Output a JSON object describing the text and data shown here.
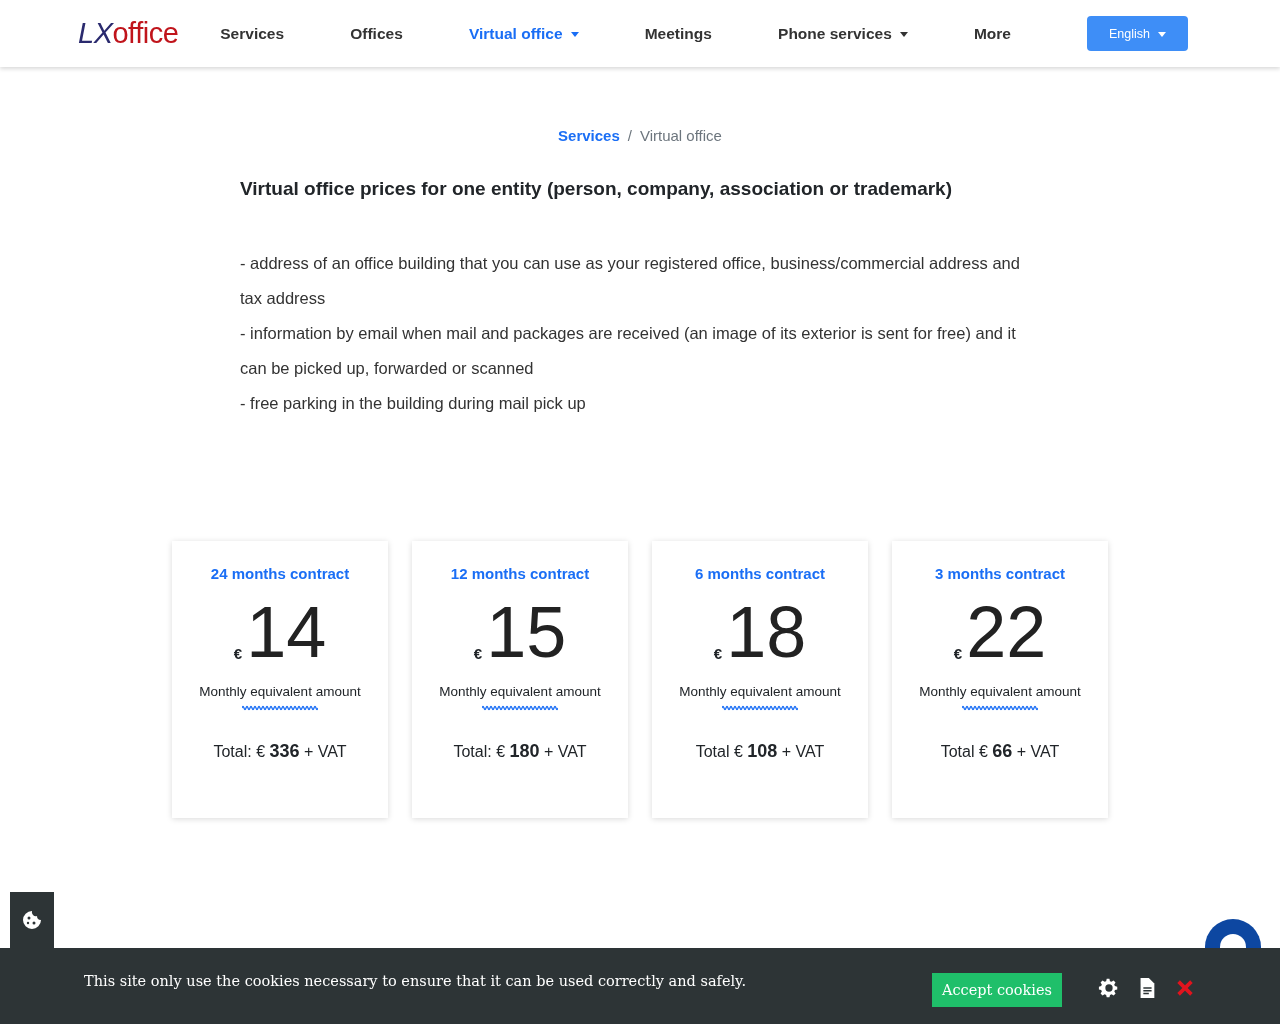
{
  "header": {
    "logo": {
      "part_1": "LX",
      "part_2": "office"
    },
    "nav": [
      {
        "label": "Services",
        "selected": false,
        "dropdown": false
      },
      {
        "label": "Offices",
        "selected": false,
        "dropdown": false
      },
      {
        "label": "Virtual office",
        "selected": true,
        "dropdown": true
      },
      {
        "label": "Meetings",
        "selected": false,
        "dropdown": false
      },
      {
        "label": "Phone services",
        "selected": false,
        "dropdown": true
      },
      {
        "label": "More",
        "selected": false,
        "dropdown": false
      }
    ],
    "language_button": "English"
  },
  "breadcrumb": [
    {
      "label": "Services",
      "link": true
    },
    {
      "label": "Virtual office",
      "link": false
    }
  ],
  "breadcrumb_separator": "/",
  "heading": "Virtual office prices for one entity (person, company, association or trademark)",
  "features": [
    "- address of an office building that you can use as your registered office, business/commercial address and tax address",
    "- information by email when mail and packages are received (an image of its exterior is sent for free) and it can be picked up, forwarded or scanned",
    "- free parking in the building during mail pick up"
  ],
  "plans": [
    {
      "title": "24 months contract",
      "currency": "€",
      "amount": "14",
      "label": "Monthly equivalent amount",
      "total": "Total: € **336** + VAT"
    },
    {
      "title": "12 months contract",
      "currency": "€",
      "amount": "15",
      "label": "Monthly equivalent amount",
      "total": "Total: € **180** + VAT"
    },
    {
      "title": "6 months contract",
      "currency": "€",
      "amount": "18",
      "label": "Monthly equivalent amount",
      "total": "Total € **108** + VAT"
    },
    {
      "title": "3 months contract",
      "currency": "€",
      "amount": "22",
      "label": "Monthly equivalent amount",
      "total": "Total € **66** + VAT"
    }
  ],
  "cookie_banner": {
    "message": "This site only use the cookies necessary to ensure that it can be used correctly and safely.",
    "accept_button": "Accept cookies"
  }
}
